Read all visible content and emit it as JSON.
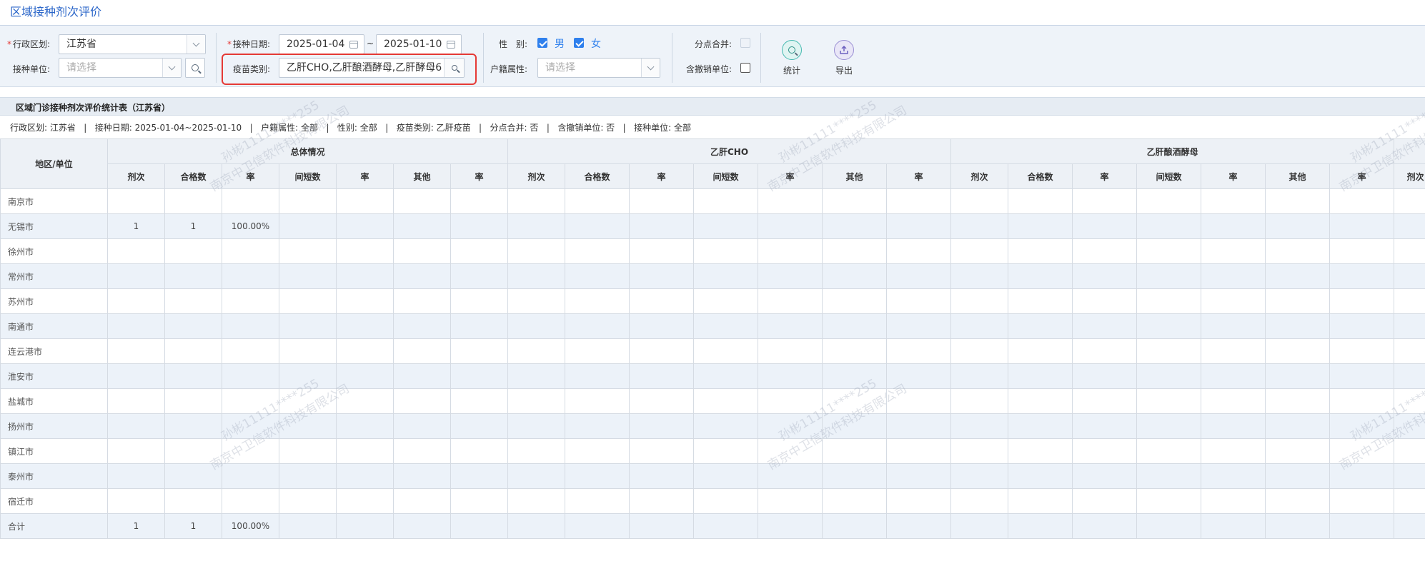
{
  "title": "区域接种剂次评价",
  "filters": {
    "region_label": "行政区划:",
    "region_value": "江苏省",
    "unit_label": "接种单位:",
    "unit_placeholder": "请选择",
    "date_label": "接种日期:",
    "date_start": "2025-01-04",
    "date_sep": "~",
    "date_end": "2025-01-10",
    "vaccine_label": "疫苗类别:",
    "vaccine_value": "乙肝CHO,乙肝酿酒酵母,乙肝酵母6",
    "gender_label": "性　别:",
    "gender_male": "男",
    "gender_female": "女",
    "household_label": "户籍属性:",
    "household_placeholder": "请选择",
    "merge_label": "分点合并:",
    "revoked_label": "含撤销单位:",
    "stat_button": "统计",
    "export_button": "导出"
  },
  "report": {
    "title": "区域门诊接种剂次评价统计表（江苏省）",
    "summary": [
      "行政区划: 江苏省",
      "接种日期: 2025-01-04~2025-01-10",
      "户籍属性: 全部",
      "性别: 全部",
      "疫苗类别: 乙肝疫苗",
      "分点合并: 否",
      "含撤销单位: 否",
      "接种单位: 全部"
    ],
    "summary_sep": "|",
    "area_header": "地区/单位",
    "group_headers": [
      "总体情况",
      "乙肝CHO",
      "乙肝酿酒酵母"
    ],
    "sub_headers": [
      "剂次",
      "合格数",
      "率",
      "间短数",
      "率",
      "其他",
      "率"
    ],
    "trailing_header": "剂次",
    "rows": [
      {
        "name": "南京市",
        "cells": [
          "",
          "",
          "",
          "",
          "",
          "",
          ""
        ]
      },
      {
        "name": "无锡市",
        "cells": [
          "1",
          "1",
          "100.00%",
          "",
          "",
          "",
          ""
        ]
      },
      {
        "name": "徐州市",
        "cells": [
          "",
          "",
          "",
          "",
          "",
          "",
          ""
        ]
      },
      {
        "name": "常州市",
        "cells": [
          "",
          "",
          "",
          "",
          "",
          "",
          ""
        ]
      },
      {
        "name": "苏州市",
        "cells": [
          "",
          "",
          "",
          "",
          "",
          "",
          ""
        ]
      },
      {
        "name": "南通市",
        "cells": [
          "",
          "",
          "",
          "",
          "",
          "",
          ""
        ]
      },
      {
        "name": "连云港市",
        "cells": [
          "",
          "",
          "",
          "",
          "",
          "",
          ""
        ]
      },
      {
        "name": "淮安市",
        "cells": [
          "",
          "",
          "",
          "",
          "",
          "",
          ""
        ]
      },
      {
        "name": "盐城市",
        "cells": [
          "",
          "",
          "",
          "",
          "",
          "",
          ""
        ]
      },
      {
        "name": "扬州市",
        "cells": [
          "",
          "",
          "",
          "",
          "",
          "",
          ""
        ]
      },
      {
        "name": "镇江市",
        "cells": [
          "",
          "",
          "",
          "",
          "",
          "",
          ""
        ]
      },
      {
        "name": "泰州市",
        "cells": [
          "",
          "",
          "",
          "",
          "",
          "",
          ""
        ]
      },
      {
        "name": "宿迁市",
        "cells": [
          "",
          "",
          "",
          "",
          "",
          "",
          ""
        ]
      },
      {
        "name": "合计",
        "cells": [
          "1",
          "1",
          "100.00%",
          "",
          "",
          "",
          ""
        ]
      }
    ]
  },
  "watermark": {
    "line1": "孙彬11111****255",
    "line2": "南京中卫信软件科技有限公司"
  },
  "colors": {
    "accent": "#2f80ed",
    "title": "#2b66c9",
    "highlight": "#e53935"
  }
}
